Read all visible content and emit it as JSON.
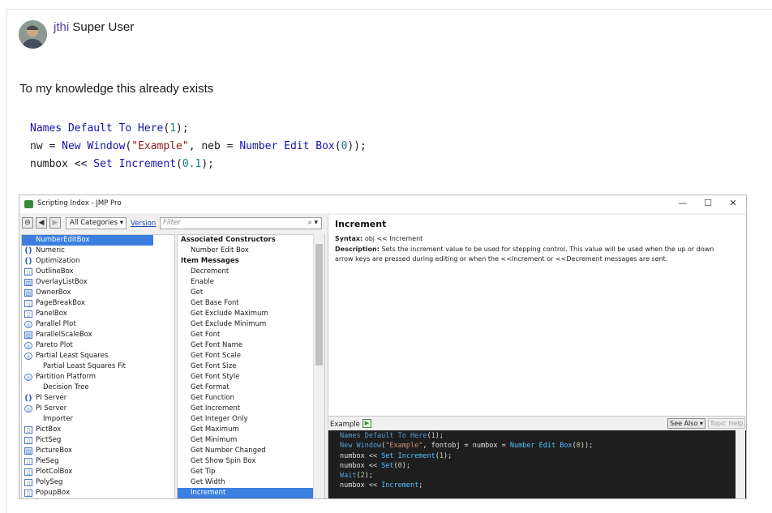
{
  "post": {
    "author_name": "jthi",
    "author_rank": "Super User",
    "text": "To my knowledge this already exists",
    "code_lines": [
      "Names Default To Here(1);",
      "nw = New Window(\"Example\", neb = Number Edit Box(0));",
      "numbox << Set Increment(0.1);"
    ]
  },
  "jmp": {
    "window_title": "Scripting Index - JMP Pro",
    "controls": {
      "minimize": "—",
      "maximize": "☐",
      "close": "✕"
    },
    "category": "All Categories",
    "version_link": "Version",
    "filter_placeholder": "Filter",
    "left_items": [
      {
        "label": "NumberEditBox",
        "icon": "box-icon",
        "selected": true
      },
      {
        "label": "Numeric",
        "icon": "paren-icon"
      },
      {
        "label": "Optimization",
        "icon": "paren-icon"
      },
      {
        "label": "OutlineBox",
        "icon": "box-icon"
      },
      {
        "label": "OverlayListBox",
        "icon": "display-icon"
      },
      {
        "label": "OwnerBox",
        "icon": "display-icon"
      },
      {
        "label": "PageBreakBox",
        "icon": "box-icon"
      },
      {
        "label": "PanelBox",
        "icon": "box-icon"
      },
      {
        "label": "Parallel Plot",
        "icon": "platform-icon"
      },
      {
        "label": "ParallelScaleBox",
        "icon": "display-icon"
      },
      {
        "label": "Pareto Plot",
        "icon": "platform-icon"
      },
      {
        "label": "Partial Least Squares",
        "icon": "platform-icon"
      },
      {
        "label": "Partial Least Squares Fit",
        "icon": "none",
        "indent": true
      },
      {
        "label": "Partition Platform",
        "icon": "platform-icon"
      },
      {
        "label": "Decision Tree",
        "icon": "none",
        "indent": true
      },
      {
        "label": "PI Server",
        "icon": "paren-icon"
      },
      {
        "label": "PI Server",
        "icon": "platform-icon"
      },
      {
        "label": "Importer",
        "icon": "none",
        "indent": true
      },
      {
        "label": "PictBox",
        "icon": "box-icon"
      },
      {
        "label": "PictSeg",
        "icon": "box-icon"
      },
      {
        "label": "PictureBox",
        "icon": "display-icon"
      },
      {
        "label": "PieSeg",
        "icon": "box-icon"
      },
      {
        "label": "PlotColBox",
        "icon": "box-icon"
      },
      {
        "label": "PolySeg",
        "icon": "box-icon"
      },
      {
        "label": "PopupBox",
        "icon": "box-icon"
      }
    ],
    "mid_items": [
      {
        "label": "Associated Constructors",
        "head": true
      },
      {
        "label": "Number Edit Box"
      },
      {
        "label": "Item Messages",
        "head": true
      },
      {
        "label": "Decrement"
      },
      {
        "label": "Enable"
      },
      {
        "label": "Get"
      },
      {
        "label": "Get Base Font"
      },
      {
        "label": "Get Exclude Maximum"
      },
      {
        "label": "Get Exclude Minimum"
      },
      {
        "label": "Get Font"
      },
      {
        "label": "Get Font Name"
      },
      {
        "label": "Get Font Scale"
      },
      {
        "label": "Get Font Size"
      },
      {
        "label": "Get Font Style"
      },
      {
        "label": "Get Format"
      },
      {
        "label": "Get Function"
      },
      {
        "label": "Get Increment"
      },
      {
        "label": "Get Integer Only"
      },
      {
        "label": "Get Maximum"
      },
      {
        "label": "Get Minimum"
      },
      {
        "label": "Get Number Changed"
      },
      {
        "label": "Get Show Spin Box"
      },
      {
        "label": "Get Tip"
      },
      {
        "label": "Get Width"
      },
      {
        "label": "Increment",
        "selected": true
      }
    ],
    "doc": {
      "title": "Increment",
      "syntax_label": "Syntax:",
      "syntax": "obj << Increment",
      "desc_label": "Description:",
      "desc": "Sets the increment value to be used for stepping control.  This value will be used when the up or down arrow keys are pressed during editing or when the <<Increment or <<Decrement messages are sent."
    },
    "example_label": "Example",
    "see_also": "See Also ▾",
    "topic_help": "Topic Help",
    "example_code": [
      "Names Default To Here(1);",
      "New Window(\"Example\", fontobj = numbox = Number Edit Box(0));",
      "numbox << Set Increment(1);",
      "numbox << Set(0);",
      "Wait(2);",
      "numbox << Increment;"
    ]
  }
}
